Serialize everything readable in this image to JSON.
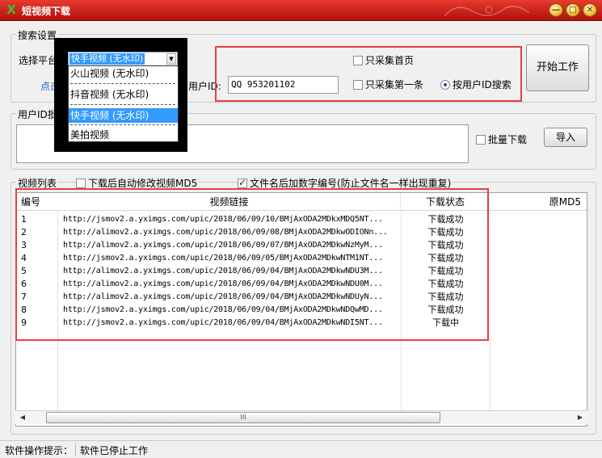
{
  "window": {
    "title": "短视频下载",
    "min_glyph": "—",
    "max_glyph": "□",
    "close_glyph": "✕"
  },
  "search_settings": {
    "group_label": "搜索设置",
    "platform_label": "选择平台：",
    "platform_selected": "快手视频 (无水印)",
    "platform_options": [
      "火山视频 (无水印)",
      "抖音视频 (无水印)",
      "快手视频 (无水印)",
      "美拍视频"
    ],
    "link_text": "点击这",
    "user_id_label": "用户ID:",
    "user_id_value": "QQ 953201102",
    "only_first_page": "只采集首页",
    "only_first_item": "只采集第一条",
    "by_user_id": "按用户ID搜索",
    "start_button": "开始工作"
  },
  "batch": {
    "group_label": "用户ID批量",
    "batch_download_label": "批量下载",
    "import_button": "导入"
  },
  "video_list": {
    "group_label": "视频列表",
    "auto_md5_label": "下载后自动修改视频MD5",
    "append_number_label": "文件名后加数字编号(防止文件名一样出现重复)",
    "columns": [
      "编号",
      "视频链接",
      "下载状态",
      "原MD5"
    ],
    "rows": [
      {
        "no": "1",
        "url": "http://jsmov2.a.yximgs.com/upic/2018/06/09/10/BMjAxODA2MDkxMDQ5NT...",
        "status": "下载成功"
      },
      {
        "no": "2",
        "url": "http://alimov2.a.yximgs.com/upic/2018/06/09/08/BMjAxODA2MDkwODIONn...",
        "status": "下载成功"
      },
      {
        "no": "3",
        "url": "http://alimov2.a.yximgs.com/upic/2018/06/09/07/BMjAxODA2MDkwNzMyM...",
        "status": "下载成功"
      },
      {
        "no": "4",
        "url": "http://jsmov2.a.yximgs.com/upic/2018/06/09/05/BMjAxODA2MDkwNTM1NT...",
        "status": "下载成功"
      },
      {
        "no": "5",
        "url": "http://alimov2.a.yximgs.com/upic/2018/06/09/04/BMjAxODA2MDkwNDU3M...",
        "status": "下载成功"
      },
      {
        "no": "6",
        "url": "http://alimov2.a.yximgs.com/upic/2018/06/09/04/BMjAxODA2MDkwNDU0M...",
        "status": "下载成功"
      },
      {
        "no": "7",
        "url": "http://alimov2.a.yximgs.com/upic/2018/06/09/04/BMjAxODA2MDkwNDUyN...",
        "status": "下载成功"
      },
      {
        "no": "8",
        "url": "http://jsmov2.a.yximgs.com/upic/2018/06/09/04/BMjAxODA2MDkwNDQwMD...",
        "status": "下载成功"
      },
      {
        "no": "9",
        "url": "http://jsmov2.a.yximgs.com/upic/2018/06/09/04/BMjAxODA2MDkwNDI5NT...",
        "status": "下载中"
      }
    ],
    "scroll_left": "◀",
    "scroll_right": "▶",
    "scroll_grip": "III"
  },
  "status_bar": {
    "hint_label": "软件操作提示：",
    "message": "软件已停止工作"
  },
  "colors": {
    "title_bar": "#c8221a",
    "highlight_box": "#e84040",
    "selection": "#3399ff"
  }
}
